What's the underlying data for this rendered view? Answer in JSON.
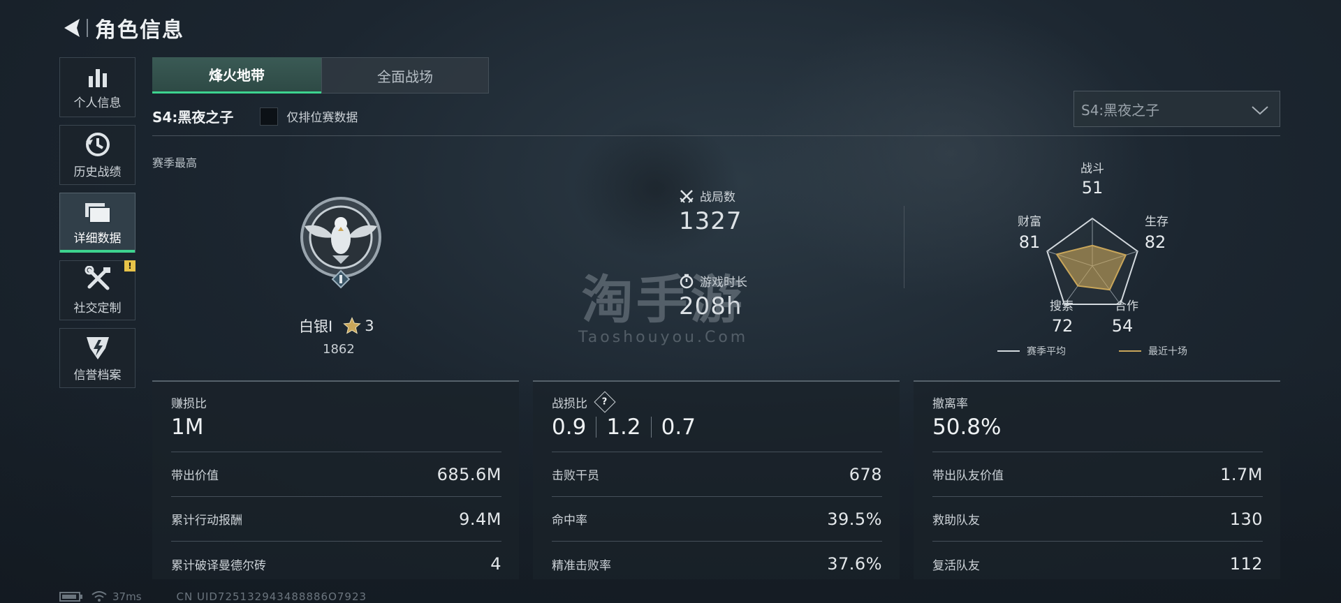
{
  "header": {
    "title": "角色信息"
  },
  "sidebar": {
    "items": [
      {
        "label": "个人信息",
        "icon": "bar-chart-icon"
      },
      {
        "label": "历史战绩",
        "icon": "history-icon"
      },
      {
        "label": "详细数据",
        "icon": "folder-icon",
        "active": true
      },
      {
        "label": "社交定制",
        "icon": "tools-icon",
        "badge": "!"
      },
      {
        "label": "信誉档案",
        "icon": "reputation-icon"
      }
    ]
  },
  "tabs": [
    {
      "label": "烽火地带",
      "active": true
    },
    {
      "label": "全面战场",
      "active": false
    }
  ],
  "season": {
    "title": "S4:黑夜之子",
    "ranked_only_label": "仅排位赛数据",
    "select_value": "S4:黑夜之子"
  },
  "season_best": {
    "label": "赛季最高",
    "rank_name": "白银I",
    "rank_stars": "3",
    "rank_score": "1862"
  },
  "summary": {
    "matches_label": "战局数",
    "matches_value": "1327",
    "playtime_label": "游戏时长",
    "playtime_value": "208h"
  },
  "watermark": {
    "text": "淘手游",
    "sub": "Taoshouyou.Com"
  },
  "radar": {
    "axes": [
      {
        "label": "战斗",
        "value": "51"
      },
      {
        "label": "生存",
        "value": "82"
      },
      {
        "label": "合作",
        "value": "54"
      },
      {
        "label": "搜索",
        "value": "72"
      },
      {
        "label": "财富",
        "value": "81"
      }
    ],
    "recent_fractions": [
      0.43,
      0.74,
      0.62,
      0.52,
      0.79
    ],
    "legend_avg": "赛季平均",
    "legend_recent": "最近十场",
    "avg_color": "#d4dadf",
    "recent_color": "#c9a65a"
  },
  "panels": {
    "profit": {
      "title": "赚损比",
      "main": "1M",
      "rows": [
        {
          "label": "带出价值",
          "value": "685.6M"
        },
        {
          "label": "累计行动报酬",
          "value": "9.4M"
        },
        {
          "label": "累计破译曼德尔砖",
          "value": "4"
        }
      ]
    },
    "combat": {
      "title": "战损比",
      "help": "?",
      "main_values": [
        "0.9",
        "1.2",
        "0.7"
      ],
      "rows": [
        {
          "label": "击败干员",
          "value": "678"
        },
        {
          "label": "命中率",
          "value": "39.5%"
        },
        {
          "label": "精准击败率",
          "value": "37.6%"
        }
      ]
    },
    "extract": {
      "title": "撤离率",
      "main": "50.8%",
      "rows": [
        {
          "label": "带出队友价值",
          "value": "1.7M"
        },
        {
          "label": "救助队友",
          "value": "130"
        },
        {
          "label": "复活队友",
          "value": "112"
        }
      ]
    }
  },
  "status": {
    "ping": "37ms",
    "uid": "CN UID725132943488886O7923"
  },
  "colors": {
    "accent": "#3dd38f",
    "warning": "#e7c349"
  }
}
